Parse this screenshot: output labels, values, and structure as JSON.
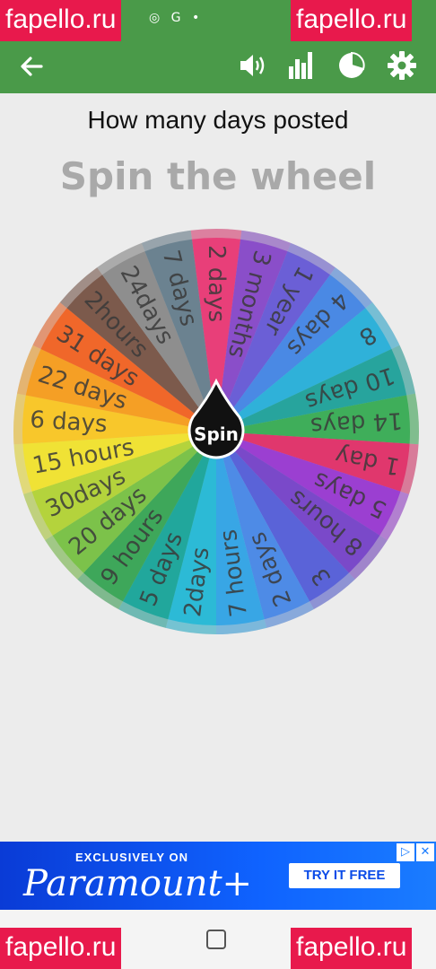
{
  "status_bar": {
    "icons_text": "◎ G •"
  },
  "watermarks": [
    "fapello.ru",
    "fapello.ru",
    "fapello.ru",
    "fapello.ru"
  ],
  "header": {
    "back_icon": "arrow-left-icon",
    "icons": [
      "volume-icon",
      "bar-chart-icon",
      "pie-chart-icon",
      "gear-icon"
    ]
  },
  "title": "How many days posted",
  "subtitle": "Spin the wheel",
  "wheel": {
    "spin_label": "Spin",
    "segments": [
      {
        "label": "2 days",
        "color": "#e83f79"
      },
      {
        "label": "3 months",
        "color": "#8a4ec9"
      },
      {
        "label": "1 year",
        "color": "#6b5fd6"
      },
      {
        "label": "4 days",
        "color": "#4a89e4"
      },
      {
        "label": "8",
        "color": "#2fb1d9"
      },
      {
        "label": "10 days",
        "color": "#27a49d"
      },
      {
        "label": "14 days",
        "color": "#3fae5a"
      },
      {
        "label": "1 day",
        "color": "#e0376d"
      },
      {
        "label": "5 days",
        "color": "#9b3fd1"
      },
      {
        "label": "8 hours",
        "color": "#7a49c9"
      },
      {
        "label": "3",
        "color": "#5a63d8"
      },
      {
        "label": "2 days",
        "color": "#4e8be6"
      },
      {
        "label": "7 hours",
        "color": "#38a6e5"
      },
      {
        "label": "2days",
        "color": "#2cbad6"
      },
      {
        "label": "5 days",
        "color": "#21a79c"
      },
      {
        "label": "9 hours",
        "color": "#3ea75a"
      },
      {
        "label": "20 days",
        "color": "#7cc24a"
      },
      {
        "label": "30days",
        "color": "#b4d33c"
      },
      {
        "label": "15 hours",
        "color": "#f0e235"
      },
      {
        "label": "6 days",
        "color": "#f8c72b"
      },
      {
        "label": "22 days",
        "color": "#f59f25"
      },
      {
        "label": "31 days",
        "color": "#f0672a"
      },
      {
        "label": "2hours",
        "color": "#7c5a4c"
      },
      {
        "label": "24days",
        "color": "#8e8e8e"
      },
      {
        "label": "7 days",
        "color": "#6b8290"
      }
    ]
  },
  "ad": {
    "top_text": "EXCLUSIVELY ON",
    "brand": "Paramount+",
    "cta": "TRY IT FREE"
  },
  "nav": {
    "home_icon": "home-square-icon"
  }
}
